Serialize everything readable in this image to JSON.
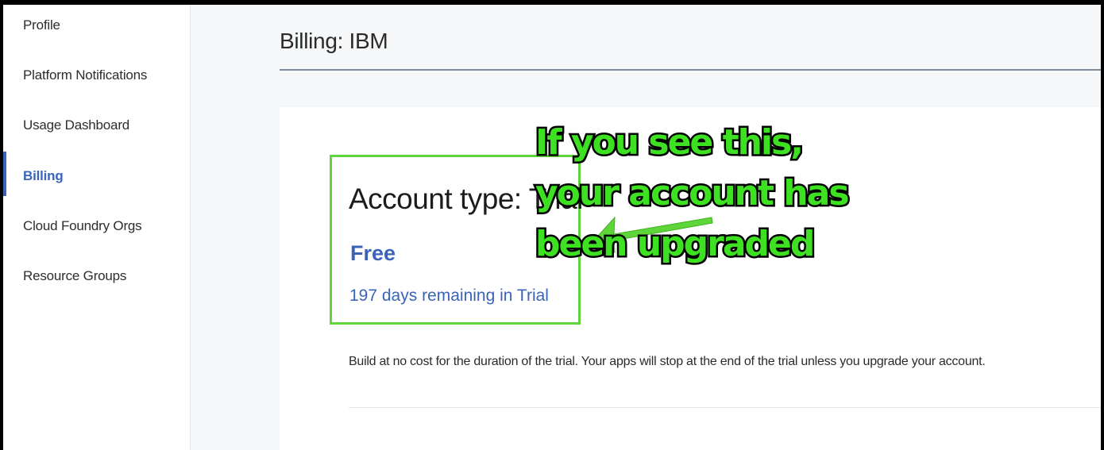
{
  "sidebar": {
    "items": [
      {
        "label": "Profile",
        "active": false
      },
      {
        "label": "Platform Notifications",
        "active": false
      },
      {
        "label": "Usage Dashboard",
        "active": false
      },
      {
        "label": "Billing",
        "active": true
      },
      {
        "label": "Cloud Foundry Orgs",
        "active": false
      },
      {
        "label": "Resource Groups",
        "active": false
      }
    ]
  },
  "page": {
    "title": "Billing: IBM"
  },
  "account": {
    "type_label": "Account type: Trial",
    "plan": "Free",
    "days_remaining": "197 days remaining in Trial",
    "description": "Build at no cost for the duration of the trial. Your apps will stop at the end of the trial unless you upgrade your account."
  },
  "annotation": {
    "lines": [
      "If you see this,",
      "your account has",
      "been upgraded"
    ],
    "color": "#3ee022",
    "outline_color": "#000000"
  },
  "colors": {
    "accent": "#3b64b8",
    "highlight": "#5ed63a",
    "arrow": "#5ed63a"
  }
}
